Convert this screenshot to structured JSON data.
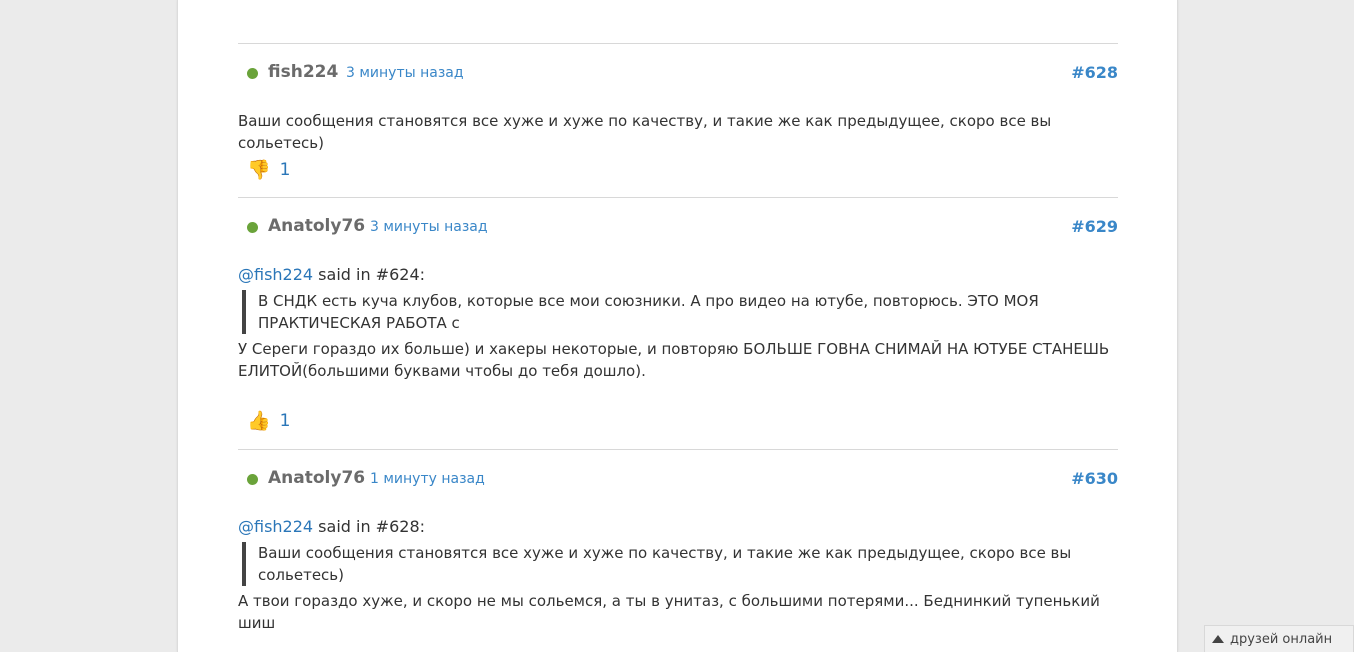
{
  "posts": [
    {
      "user": "fish224",
      "time": "3 минуты назад",
      "number": "#628",
      "text": "Ваши сообщения становятся все хуже и хуже по качеству, и такие же как предыдущее, скоро все вы сольетесь)",
      "vote": {
        "icon": "thumbs-down-icon",
        "glyph": "👎",
        "count": "1"
      }
    },
    {
      "user": "Anatoly76",
      "time": "3 минуты назад",
      "number": "#629",
      "mention": "@fish224",
      "said": " said in #624:",
      "quote": "В СНДК есть куча клубов, которые все мои союзники. А про видео на ютубе, повторюсь. ЭТО МОЯ ПРАКТИЧЕСКАЯ РАБОТА с",
      "text": "У Сереги гораздо их больше) и хакеры некоторые, и повторяю БОЛЬШЕ ГОВНА СНИМАЙ НА ЮТУБЕ СТАНЕШЬ ЕЛИТОЙ(большими буквами чтобы до тебя дошло).",
      "vote": {
        "icon": "thumbs-up-icon",
        "glyph": "👍",
        "count": "1"
      }
    },
    {
      "user": "Anatoly76",
      "time": "1 минуту назад",
      "number": "#630",
      "mention": "@fish224",
      "said": " said in #628:",
      "quote": "Ваши сообщения становятся все хуже и хуже по качеству, и такие же как предыдущее, скоро все вы сольетесь)",
      "text": "А твои гораздо хуже, и скоро не мы сольемся, а ты в унитаз, с большими потерями... Беднинкий тупенький шиш"
    }
  ],
  "friends_bar": {
    "label": "друзей онлайн",
    "icon": "triangle-up-icon"
  },
  "colors": {
    "online": "#6aa33a",
    "link": "#3a87c8",
    "background": "#ebebeb"
  }
}
